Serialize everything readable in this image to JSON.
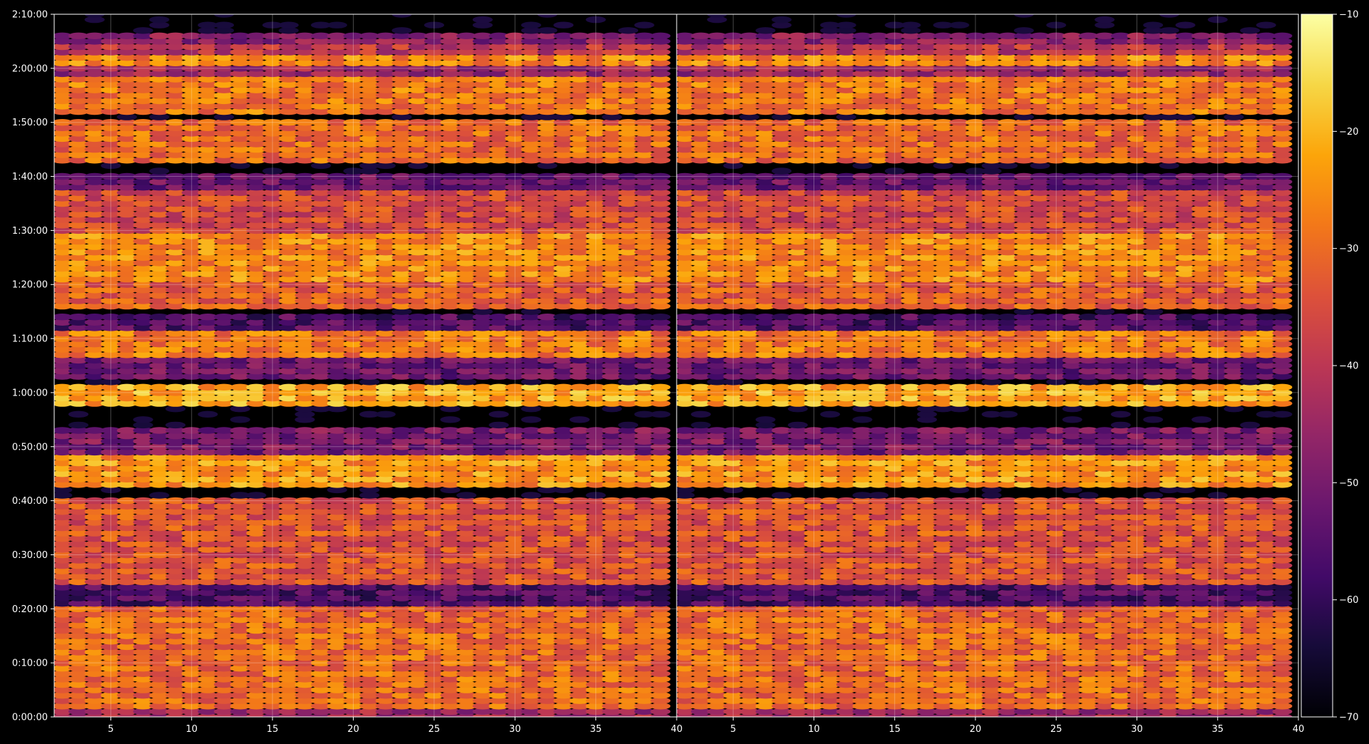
{
  "chart_data": {
    "type": "heatmap",
    "title": "",
    "panels": [
      {
        "name": "",
        "x_ticks": [
          "5",
          "10",
          "15",
          "20",
          "25",
          "30",
          "35",
          "40"
        ],
        "xlim": [
          1.5,
          40
        ]
      },
      {
        "name": "",
        "x_ticks": [
          "5",
          "10",
          "15",
          "20",
          "25",
          "30",
          "35",
          "40"
        ],
        "xlim": [
          1.5,
          40
        ]
      }
    ],
    "y_ticks": [
      "0:00:00",
      "0:10:00",
      "0:20:00",
      "0:30:00",
      "0:40:00",
      "0:50:00",
      "1:00:00",
      "1:10:00",
      "1:20:00",
      "1:30:00",
      "1:40:00",
      "1:50:00",
      "2:00:00",
      "2:10:00"
    ],
    "ylim_seconds": [
      0,
      7800
    ],
    "grid": true,
    "colorbar": {
      "colormap": "inferno",
      "range": [
        -70,
        -10
      ],
      "ticks": [
        "−10",
        "−20",
        "−30",
        "−40",
        "−50",
        "−60",
        "−70"
      ]
    },
    "x_columns": [
      2,
      3,
      4,
      5,
      6,
      7,
      8,
      9,
      10,
      11,
      12,
      13,
      14,
      15,
      16,
      17,
      18,
      19,
      20,
      21,
      22,
      23,
      24,
      25,
      26,
      27,
      28,
      29,
      30,
      31,
      32,
      33,
      34,
      35,
      36,
      37,
      38,
      39
    ],
    "y_row_spacing_seconds": 60,
    "intensity_bands": [
      {
        "from_s": 0,
        "to_s": 60,
        "level_db": -44
      },
      {
        "from_s": 120,
        "to_s": 1200,
        "level_db": -30
      },
      {
        "from_s": 1260,
        "to_s": 1440,
        "level_db": -56
      },
      {
        "from_s": 1500,
        "to_s": 2400,
        "level_db": -34
      },
      {
        "from_s": 2580,
        "to_s": 2880,
        "level_db": -24
      },
      {
        "from_s": 2940,
        "to_s": 3180,
        "level_db": -50
      },
      {
        "from_s": 3480,
        "to_s": 3660,
        "level_db": -22
      },
      {
        "from_s": 3780,
        "to_s": 3960,
        "level_db": -52
      },
      {
        "from_s": 4020,
        "to_s": 4260,
        "level_db": -28
      },
      {
        "from_s": 4320,
        "to_s": 4440,
        "level_db": -56
      },
      {
        "from_s": 4560,
        "to_s": 4800,
        "level_db": -32
      },
      {
        "from_s": 4860,
        "to_s": 5340,
        "level_db": -26
      },
      {
        "from_s": 5400,
        "to_s": 5820,
        "level_db": -36
      },
      {
        "from_s": 5880,
        "to_s": 6000,
        "level_db": -52
      },
      {
        "from_s": 6180,
        "to_s": 6600,
        "level_db": -30
      },
      {
        "from_s": 6720,
        "to_s": 7080,
        "level_db": -28
      },
      {
        "from_s": 7140,
        "to_s": 7200,
        "level_db": -45
      },
      {
        "from_s": 7260,
        "to_s": 7320,
        "level_db": -26
      },
      {
        "from_s": 7380,
        "to_s": 7440,
        "level_db": -40
      },
      {
        "from_s": 7500,
        "to_s": 7560,
        "level_db": -48
      }
    ],
    "background_db": -66
  }
}
